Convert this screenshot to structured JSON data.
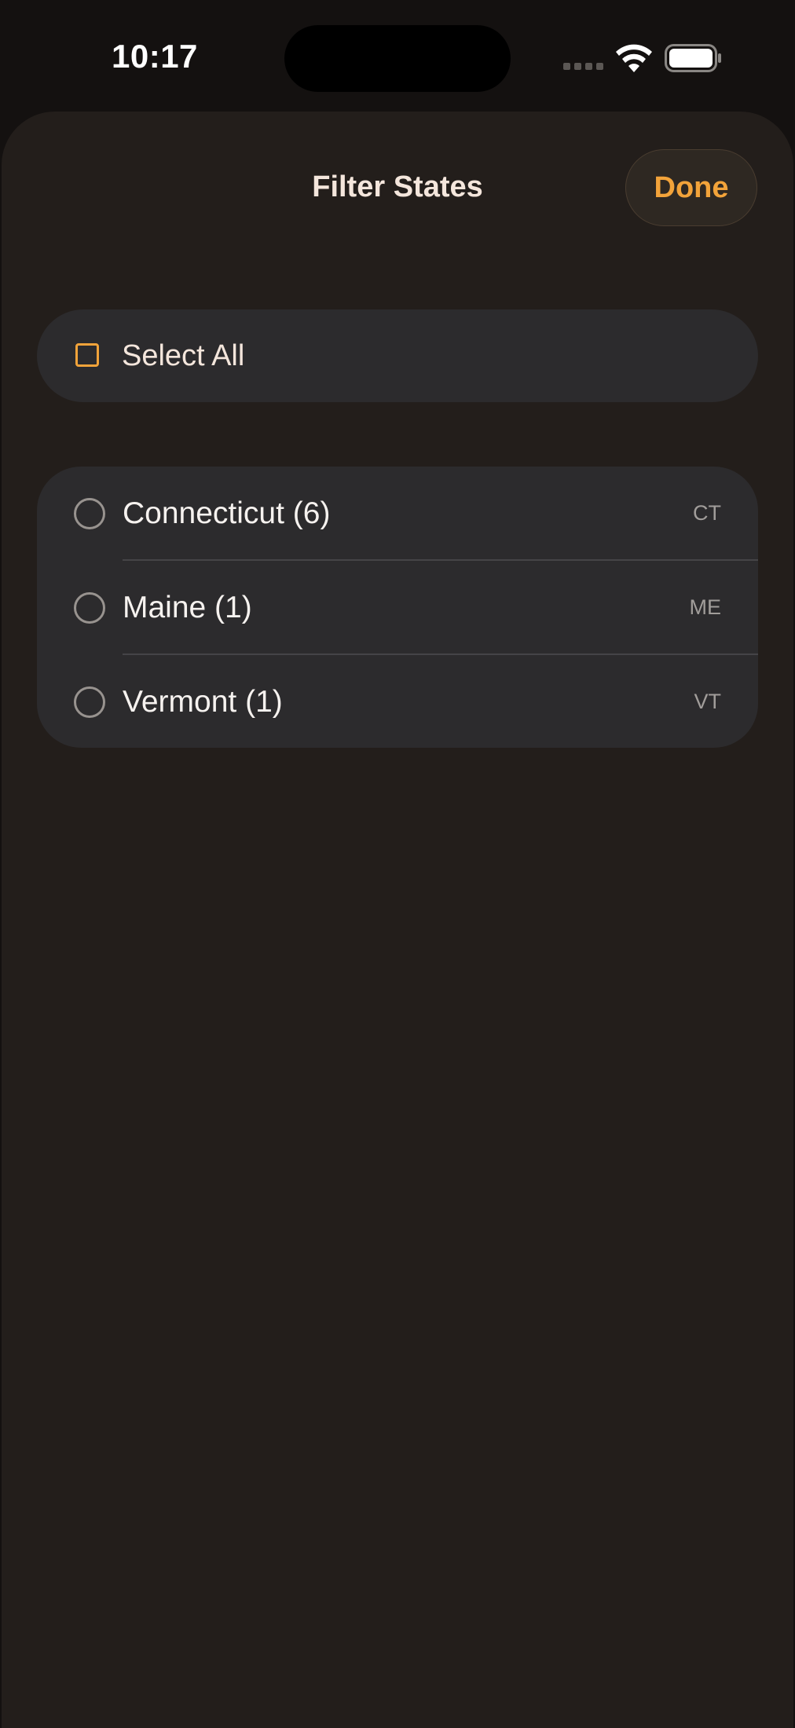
{
  "status_bar": {
    "time": "10:17",
    "icons": [
      "signal-icon",
      "wifi-icon",
      "battery-icon"
    ]
  },
  "sheet": {
    "title": "Filter States",
    "done_label": "Done"
  },
  "select_all": {
    "label": "Select All",
    "checked": false
  },
  "states": [
    {
      "name": "Connecticut (6)",
      "abbr": "CT",
      "selected": false
    },
    {
      "name": "Maine (1)",
      "abbr": "ME",
      "selected": false
    },
    {
      "name": "Vermont (1)",
      "abbr": "VT",
      "selected": false
    }
  ],
  "colors": {
    "accent": "#f2a33a",
    "background": "#231e1b",
    "card": "#2c2b2d"
  }
}
